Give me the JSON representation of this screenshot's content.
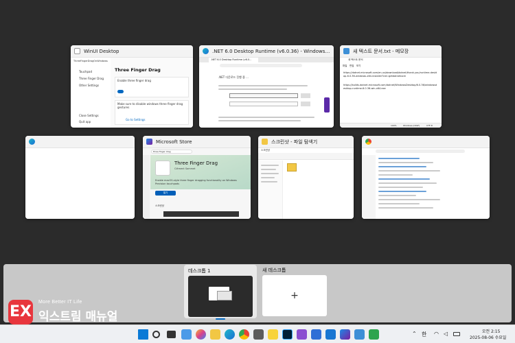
{
  "windows": {
    "winui": {
      "title": "WinUI Desktop",
      "app_name": "ThreeFingerDragOnWindows",
      "nav_items": [
        "Touchpad",
        "Three Finger Drag",
        "Other Settings"
      ],
      "nav_bottom": [
        "Close Settings",
        "Quit app"
      ],
      "heading": "Three Finger Drag",
      "option_label": "Enable three finger drag",
      "option_note": "Make sure to disable windows three finger drag gestures",
      "link": "Go to Settings"
    },
    "dotnet": {
      "title": ".NET 6.0 Desktop Runtime (v6.0.36) - Windows x64 Installer...",
      "tab": ".NET 6.0 Desktop Runtime (v6.0...",
      "notice": ".NET 다운로드 진행 중 ..."
    },
    "notepad": {
      "title": "새 텍스트 문서.txt - 메모장",
      "tab": "새 텍스트 문서",
      "menu": [
        "파일",
        "편집",
        "보기"
      ],
      "line1": "https://dotnet.microsoft.com/en-us/download/dotnet/thank-you/runtime-desktop-6.0.36-windows-x64-installer?cid=getdotnetcore",
      "line2": "https://builds.dotnet.microsoft.com/dotnet/WindowsDesktop/6.0.36/windowsdesktop-runtime-6.0.36-win-x64.exe",
      "status": [
        "100%",
        "Windows (CRLF)",
        "UTF-8"
      ]
    },
    "edge_blank": {
      "title": ""
    },
    "store": {
      "title": "Microsoft Store",
      "search": "three finger drag",
      "app_title": "Three Finger Drag",
      "publisher": "Clément Sommet",
      "description": "Enable macOS-style three finger dragging functionality on Windows Precision touchpads",
      "button": "열기",
      "section": "스크린샷"
    },
    "explorer": {
      "title": "스크린샷 - 파일 탐색기",
      "tab": "스크린샷"
    },
    "chrome": {
      "title": ""
    }
  },
  "desktops": [
    {
      "label": "데스크톱 1",
      "active": true
    },
    {
      "label": "새 데스크톱",
      "active": false,
      "plus": "+"
    }
  ],
  "taskbar": {
    "tray_ime": "한",
    "time": "오전 2:15",
    "date": "2025-08-06 수요일"
  },
  "watermark": {
    "mark": "EX",
    "tagline": "More Better IT Life",
    "name": "익스트림 매뉴얼"
  }
}
